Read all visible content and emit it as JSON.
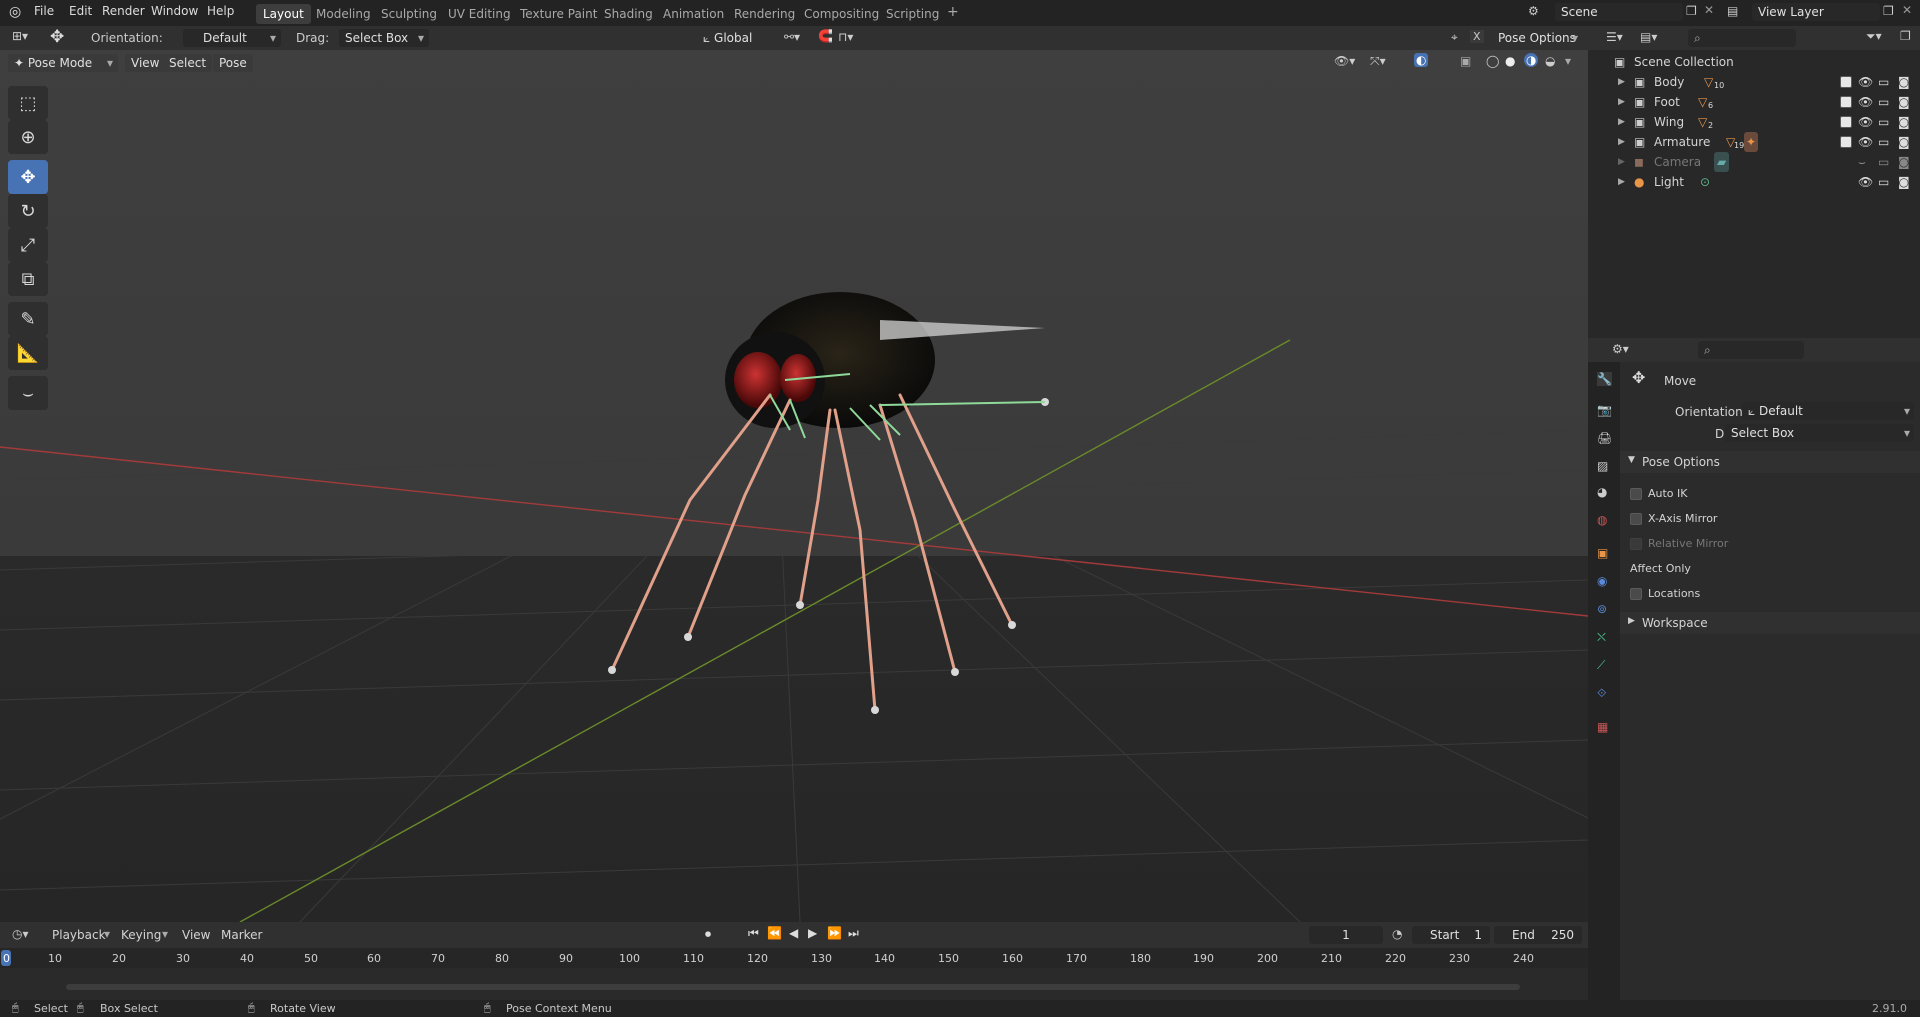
{
  "topbar": {
    "menus": [
      "File",
      "Edit",
      "Render",
      "Window",
      "Help"
    ],
    "workspaces": [
      "Layout",
      "Modeling",
      "Sculpting",
      "UV Editing",
      "Texture Paint",
      "Shading",
      "Animation",
      "Rendering",
      "Compositing",
      "Scripting"
    ],
    "active_workspace": "Layout",
    "scene": "Scene",
    "view_layer": "View Layer"
  },
  "tool_header": {
    "orientation_label": "Orientation:",
    "orientation_value": "Default",
    "drag_label": "Drag:",
    "drag_value": "Select Box",
    "transform_orientation": "Global",
    "pose_options": "Pose Options"
  },
  "viewport_header": {
    "mode": "Pose Mode",
    "menus": [
      "View",
      "Select",
      "Pose"
    ]
  },
  "outliner": {
    "root": "Scene Collection",
    "items": [
      {
        "name": "Body",
        "count": "10"
      },
      {
        "name": "Foot",
        "count": "6"
      },
      {
        "name": "Wing",
        "count": "2"
      },
      {
        "name": "Armature",
        "count": "19"
      },
      {
        "name": "Camera",
        "count": ""
      },
      {
        "name": "Light",
        "count": ""
      }
    ]
  },
  "properties": {
    "tool_name": "Move",
    "orientation_label": "Orientation",
    "orientation_value": "Default",
    "drag_label": "Drag:",
    "drag_value": "Select Box",
    "section_pose_options": "Pose Options",
    "auto_ik": "Auto IK",
    "x_axis_mirror": "X-Axis Mirror",
    "relative_mirror": "Relative Mirror",
    "affect_only": "Affect Only",
    "locations": "Locations",
    "section_workspace": "Workspace"
  },
  "timeline": {
    "menus": [
      "Playback",
      "Keying",
      "View",
      "Marker"
    ],
    "current_frame": "1",
    "start_label": "Start",
    "start_value": "1",
    "end_label": "End",
    "end_value": "250",
    "ticks": [
      "0",
      "10",
      "20",
      "30",
      "40",
      "50",
      "60",
      "70",
      "80",
      "90",
      "100",
      "110",
      "120",
      "130",
      "140",
      "150",
      "160",
      "170",
      "180",
      "190",
      "200",
      "210",
      "220",
      "230",
      "240"
    ]
  },
  "statusbar": {
    "select": "Select",
    "box_select": "Box Select",
    "rotate_view": "Rotate View",
    "context_menu": "Pose Context Menu",
    "version": "2.91.0"
  }
}
